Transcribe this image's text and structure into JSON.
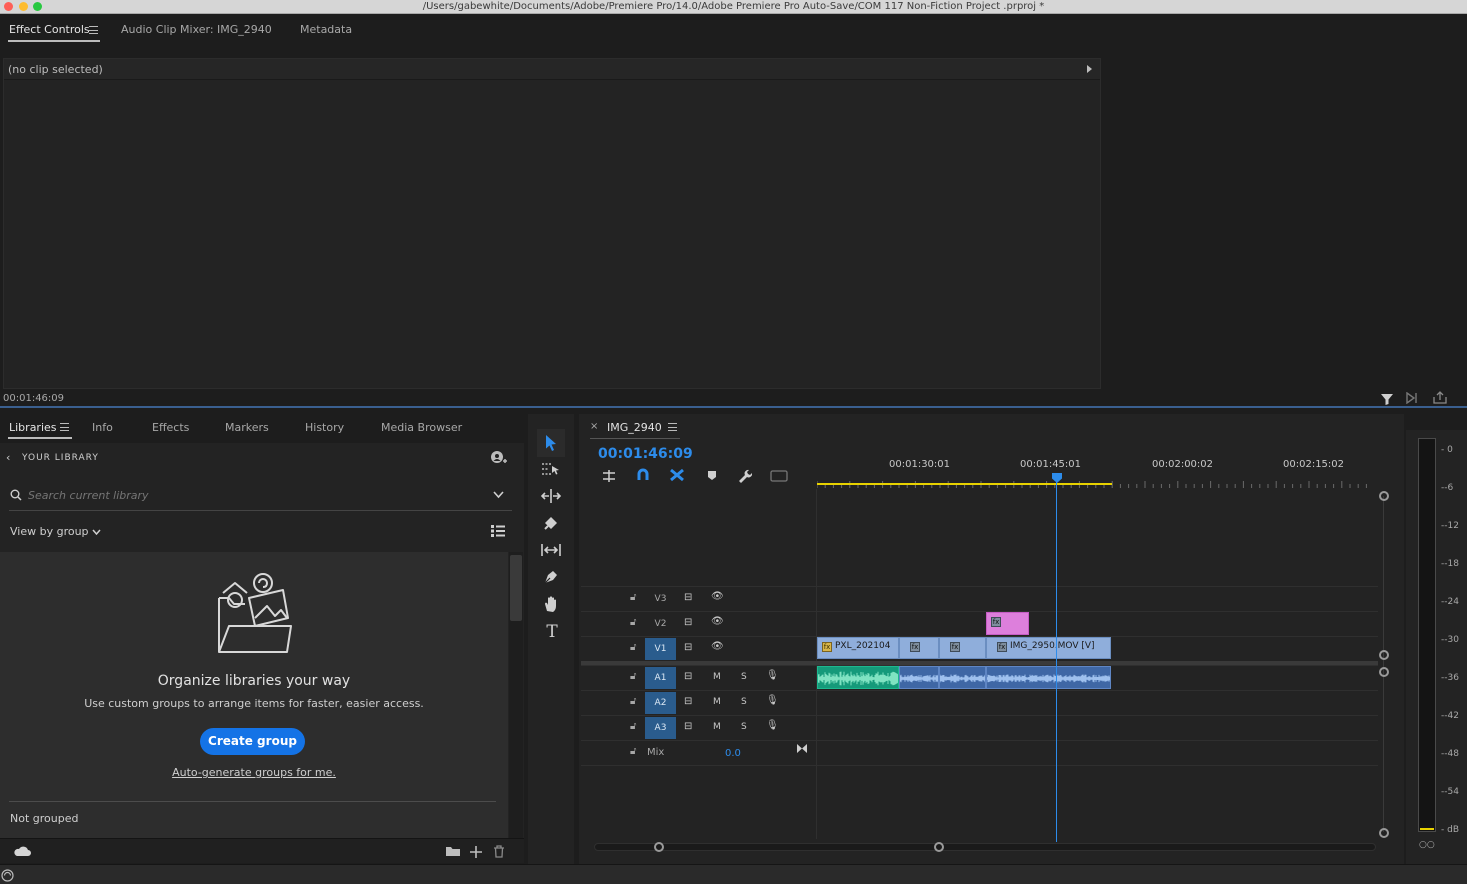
{
  "window": {
    "title": "/Users/gabewhite/Documents/Adobe/Premiere Pro/14.0/Adobe Premiere Pro Auto-Save/COM 117 Non-Fiction Project .prproj *"
  },
  "top_tabs": [
    {
      "label": "Effect Controls",
      "active": true
    },
    {
      "label": "Audio Clip Mixer: IMG_2940",
      "active": false
    },
    {
      "label": "Metadata",
      "active": false
    }
  ],
  "effect_controls": {
    "header": "(no clip selected)",
    "timecode": "00:01:46:09"
  },
  "libraries": {
    "tabs": [
      {
        "label": "Libraries",
        "active": true
      },
      {
        "label": "Info",
        "active": false
      },
      {
        "label": "Effects",
        "active": false
      },
      {
        "label": "Markers",
        "active": false
      },
      {
        "label": "History",
        "active": false
      },
      {
        "label": "Media Browser",
        "active": false
      }
    ],
    "breadcrumb": "YOUR LIBRARY",
    "search_placeholder": "Search current library",
    "view_by": "View by group",
    "empty_title": "Organize libraries your way",
    "empty_desc": "Use custom groups to arrange items for faster, easier access.",
    "create_button": "Create group",
    "auto_link": "Auto-generate groups for me.",
    "not_grouped": "Not grouped"
  },
  "timeline": {
    "sequence_name": "IMG_2940",
    "timecode": "00:01:46:09",
    "ruler_labels": [
      "00:01:30:01",
      "00:01:45:01",
      "00:02:00:02",
      "00:02:15:02"
    ],
    "tracks": {
      "v3": "V3",
      "v2": "V2",
      "v1": "V1",
      "a1": "A1",
      "a2": "A2",
      "a3": "A3",
      "mix": "Mix",
      "mix_value": "0.0",
      "mute": "M",
      "solo": "S"
    },
    "clips": {
      "v1_first": "PXL_202104",
      "v1_last": "IMG_2950.MOV [V]"
    },
    "colors": {
      "accent": "#2d8ceb",
      "work_area": "#e8d200",
      "video_clip": "#8faedb",
      "audio_clip": "#3f67a5",
      "audio_clip_green": "#159a7a",
      "adjustment_clip": "#dd7fdc"
    }
  },
  "meter": {
    "labels": [
      "0",
      "-6",
      "-12",
      "-18",
      "-24",
      "-30",
      "-36",
      "-42",
      "-48",
      "-54",
      "dB"
    ]
  }
}
